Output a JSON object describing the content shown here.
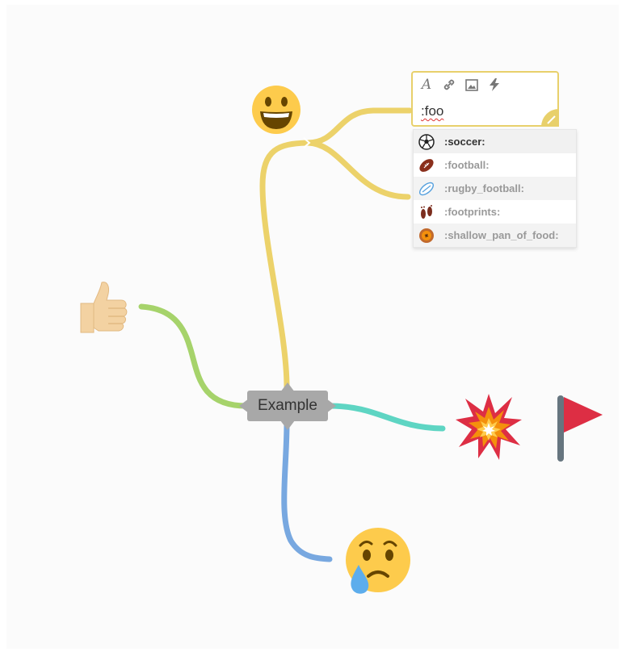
{
  "root": {
    "label": "Example"
  },
  "editor": {
    "value": ":foo",
    "tools": [
      "font-style-icon",
      "link-icon",
      "image-icon",
      "lightning-icon"
    ]
  },
  "suggestions": [
    {
      "label": ":soccer:",
      "icon": "soccer-ball-icon",
      "active": true
    },
    {
      "label": ":football:",
      "icon": "american-football-icon"
    },
    {
      "label": ":rugby_football:",
      "icon": "rugby-ball-icon"
    },
    {
      "label": ":footprints:",
      "icon": "footprints-icon"
    },
    {
      "label": ":shallow_pan_of_food:",
      "icon": "shallow-pan-icon"
    }
  ],
  "nodes": [
    "smiley-emoji",
    "thumbs-up-emoji",
    "collision-emoji",
    "red-flag-emoji",
    "crying-face-emoji"
  ],
  "colors": {
    "branch_yellow": "#ecd26a",
    "branch_green": "#a6d36b",
    "branch_teal": "#5ed5c3",
    "branch_blue": "#78a8e0",
    "root_bg": "#a8a8a8",
    "editor_border": "#e8d06b"
  }
}
